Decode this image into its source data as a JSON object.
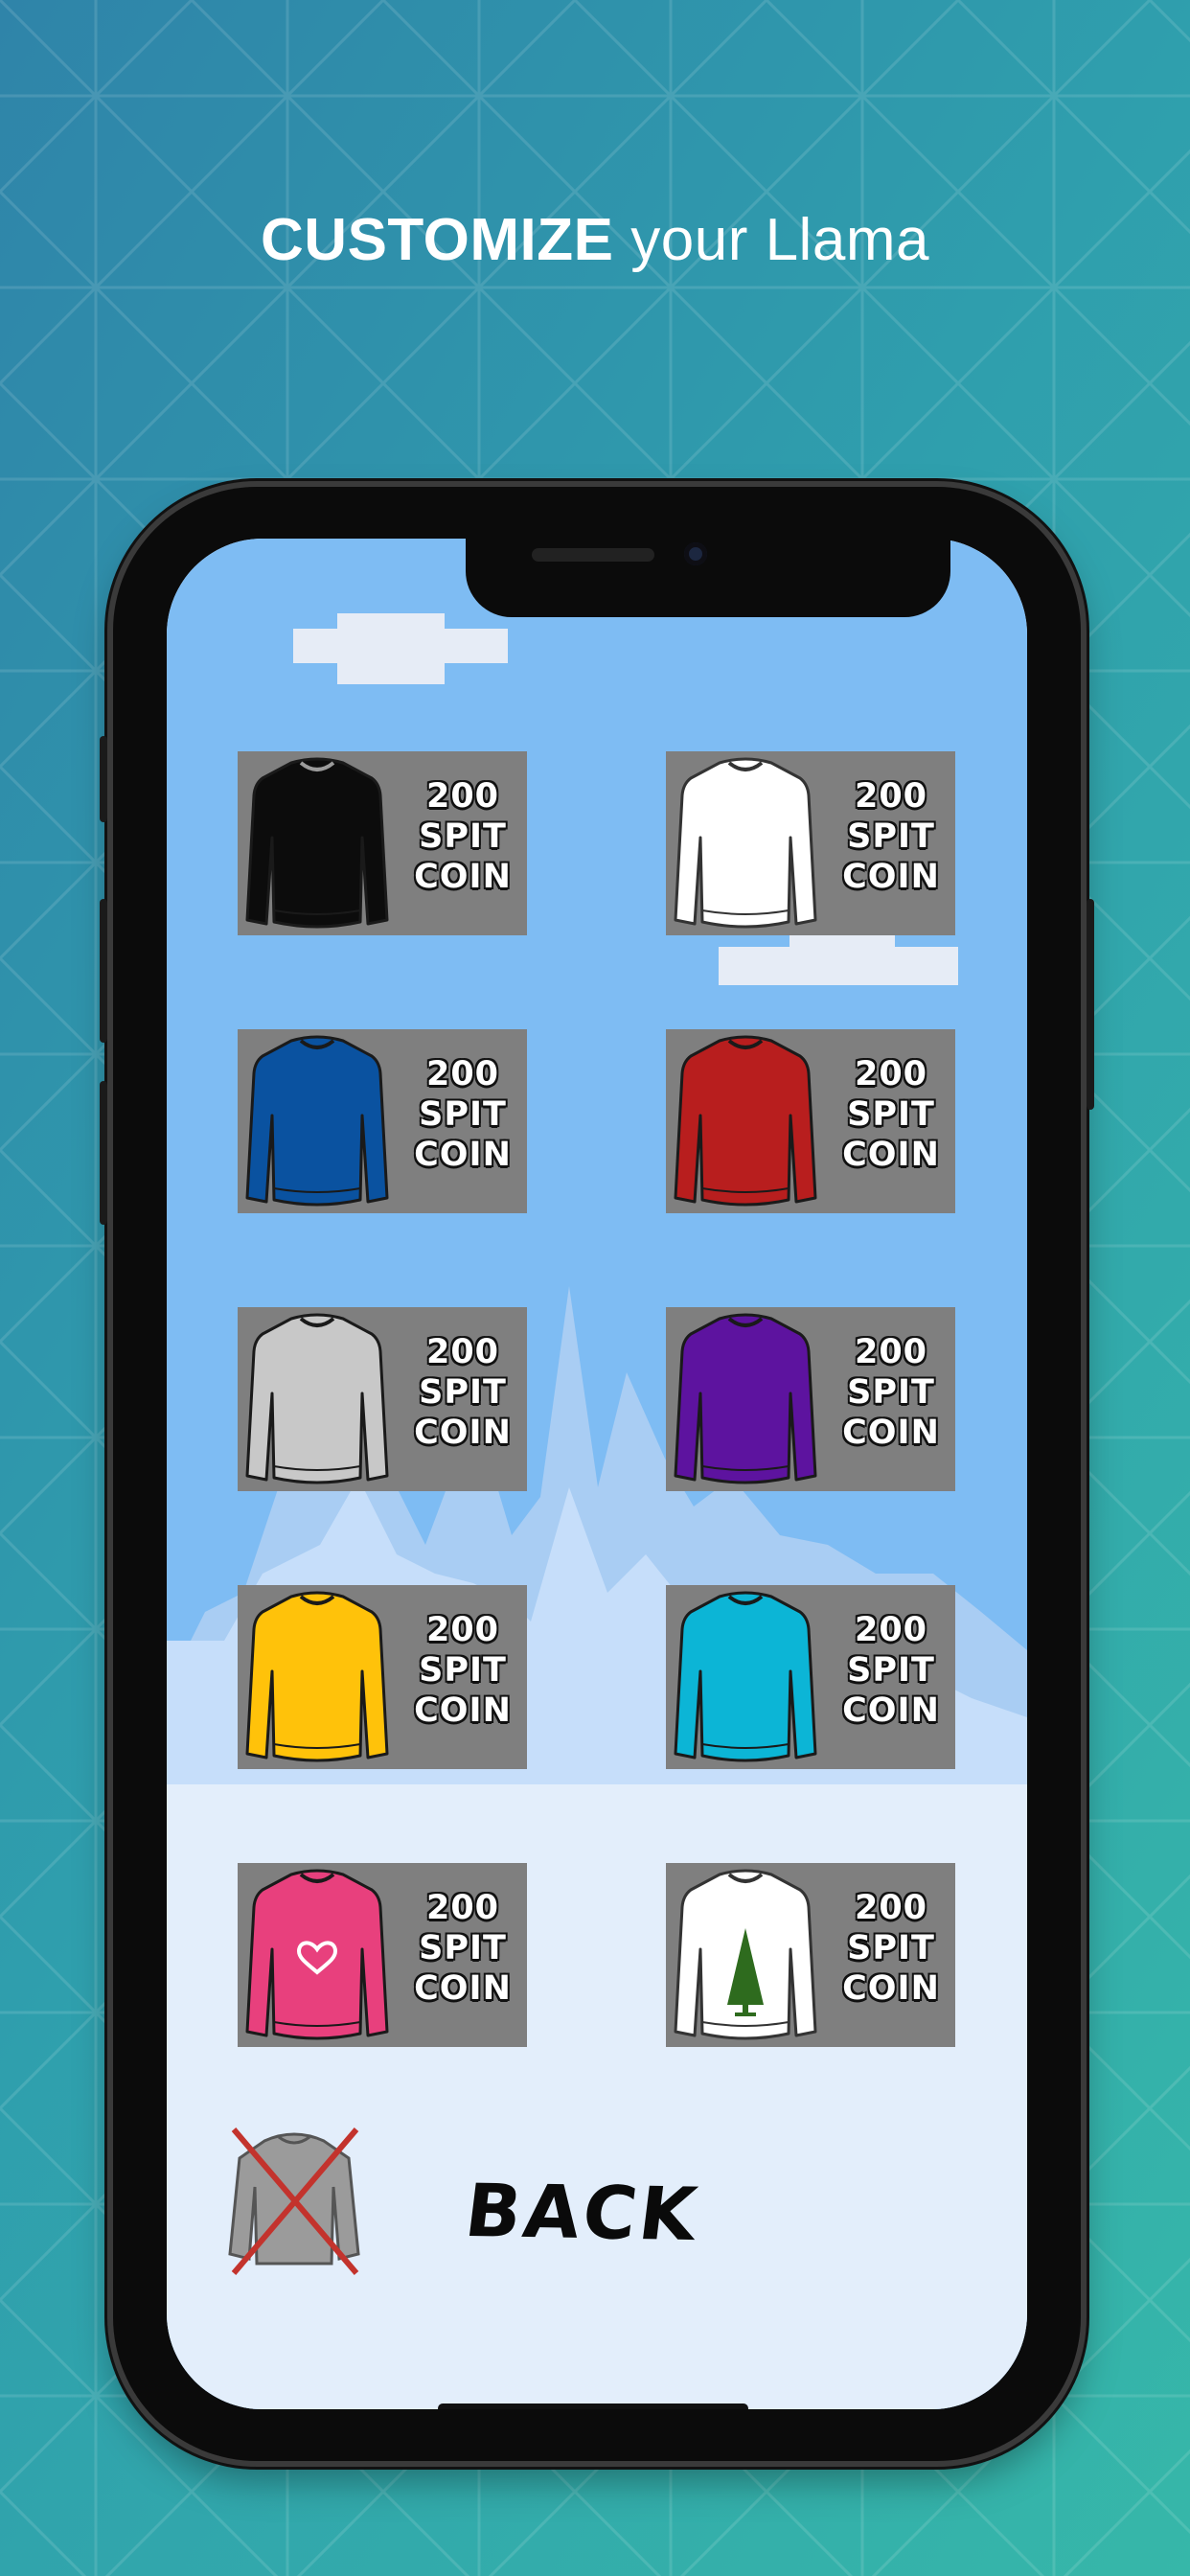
{
  "headline": {
    "bold": "CUSTOMIZE",
    "rest": " your Llama"
  },
  "colors": {
    "bg_start": "#2f84a9",
    "bg_end": "#36b7a9",
    "sky": "#7ebcf3",
    "card": "#7f7f7f"
  },
  "items": [
    {
      "name": "black-sweater",
      "color": "#0c0c0c",
      "price": [
        "200",
        "SPIT",
        "COIN"
      ]
    },
    {
      "name": "white-sweater",
      "color": "#ffffff",
      "price": [
        "200",
        "SPIT",
        "COIN"
      ]
    },
    {
      "name": "blue-sweater",
      "color": "#0a52a0",
      "price": [
        "200",
        "SPIT",
        "COIN"
      ]
    },
    {
      "name": "red-sweater",
      "color": "#b81e1e",
      "price": [
        "200",
        "SPIT",
        "COIN"
      ]
    },
    {
      "name": "gray-sweater",
      "color": "#c8c8c8",
      "price": [
        "200",
        "SPIT",
        "COIN"
      ]
    },
    {
      "name": "purple-sweater",
      "color": "#5d139f",
      "price": [
        "200",
        "SPIT",
        "COIN"
      ]
    },
    {
      "name": "yellow-sweater",
      "color": "#ffc20a",
      "price": [
        "200",
        "SPIT",
        "COIN"
      ]
    },
    {
      "name": "cyan-sweater",
      "color": "#0cb5d6",
      "price": [
        "200",
        "SPIT",
        "COIN"
      ]
    },
    {
      "name": "pink-heart-sweater",
      "color": "#e8407d",
      "price": [
        "200",
        "SPIT",
        "COIN"
      ],
      "decoration": "heart-icon"
    },
    {
      "name": "white-tree-sweater",
      "color": "#ffffff",
      "price": [
        "200",
        "SPIT",
        "COIN"
      ],
      "decoration": "tree-icon"
    }
  ],
  "controls": {
    "back_label": "BACK",
    "remove_icon": "no-sweater-icon"
  }
}
